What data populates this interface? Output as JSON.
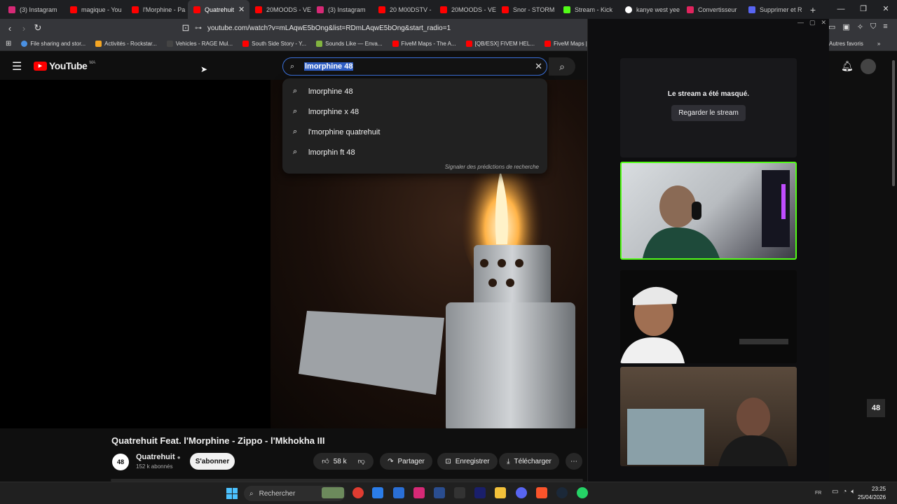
{
  "browser": {
    "tabs": [
      {
        "label": "(3) Instagram",
        "color": "#d62976"
      },
      {
        "label": "magique - You",
        "color": "#ff0000"
      },
      {
        "label": "l'Morphine - Pa",
        "color": "#ff0000"
      },
      {
        "label": "Quatrehuit",
        "color": "#ff0000",
        "active": true
      },
      {
        "label": "20MOODS - VE",
        "color": "#ff0000"
      },
      {
        "label": "(3) Instagram",
        "color": "#d62976"
      },
      {
        "label": "20 M00DSTV -",
        "color": "#ff0000"
      },
      {
        "label": "20MOODS - VE",
        "color": "#ff0000"
      },
      {
        "label": "Snor - STORM",
        "color": "#ff0000"
      },
      {
        "label": "Stream - Kick",
        "color": "#53fc18"
      },
      {
        "label": "kanye west yee",
        "color": "#ffffff"
      },
      {
        "label": "Convertisseur",
        "color": "#e0245e"
      },
      {
        "label": "Supprimer et R",
        "color": "#5865f2"
      }
    ],
    "url": "youtube.com/watch?v=mLAqwE5bOng&list=RDmLAqwE5bOng&start_radio=1",
    "bookmarks": [
      {
        "label": "File sharing and stor...",
        "color": "#4a90e2"
      },
      {
        "label": "Activités - Rockstar...",
        "color": "#f5a623"
      },
      {
        "label": "Vehicles - RAGE Mul...",
        "color": "#222222"
      },
      {
        "label": "South Side Story - Y...",
        "color": "#ff0000"
      },
      {
        "label": "Sounds Like — Enva...",
        "color": "#82b440"
      },
      {
        "label": "FiveM Maps - The A...",
        "color": "#ff0000"
      },
      {
        "label": "[QB/ESX] FIVEM HEL...",
        "color": "#ff0000"
      },
      {
        "label": "FiveM Maps | East",
        "color": "#ff0000"
      }
    ],
    "other_bookmarks": "Autres favoris"
  },
  "youtube": {
    "logo_text": "YouTube",
    "logo_region": "MA",
    "search_value": "lmorphine 48",
    "suggestions": [
      "lmorphine 48",
      "lmorphine x 48",
      "l'morphine quatrehuit",
      "lmorphin ft 48"
    ],
    "suggest_report": "Signaler des prédictions de recherche",
    "video_title": "Quatrehuit Feat. l'Morphine - Zippo - l'Mkhokha III",
    "channel_name": "Quatrehuit",
    "subscribers": "152 k abonnés",
    "subscribe_label": "S'abonner",
    "likes": "58 k",
    "share_label": "Partager",
    "save_label": "Enregistrer",
    "download_label": "Télécharger",
    "corner_badge": "48"
  },
  "overlay": {
    "hidden_message": "Le stream a été masqué.",
    "watch_button": "Regarder le stream"
  },
  "taskbar": {
    "search_label": "Rechercher",
    "time": "23:25",
    "date": "25/04/2026",
    "lang": "FR"
  },
  "colors": {
    "youtube_red": "#ff0000",
    "kick_green": "#53fc18",
    "focus_blue": "#3a6fd8"
  }
}
